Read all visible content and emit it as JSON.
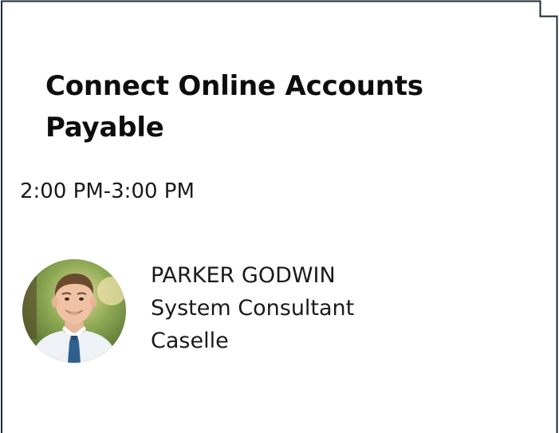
{
  "session": {
    "title": "Connect Online Accounts Payable",
    "time": "2:00 PM-3:00 PM"
  },
  "speaker": {
    "name": "PARKER GODWIN",
    "role": "System Consultant",
    "company": "Caselle",
    "avatar_icon": "speaker-photo"
  },
  "colors": {
    "border": "#1f2a33",
    "text": "#111111",
    "background": "#ffffff",
    "tie": "#2f5f8f",
    "shirt": "#eef1f5"
  }
}
